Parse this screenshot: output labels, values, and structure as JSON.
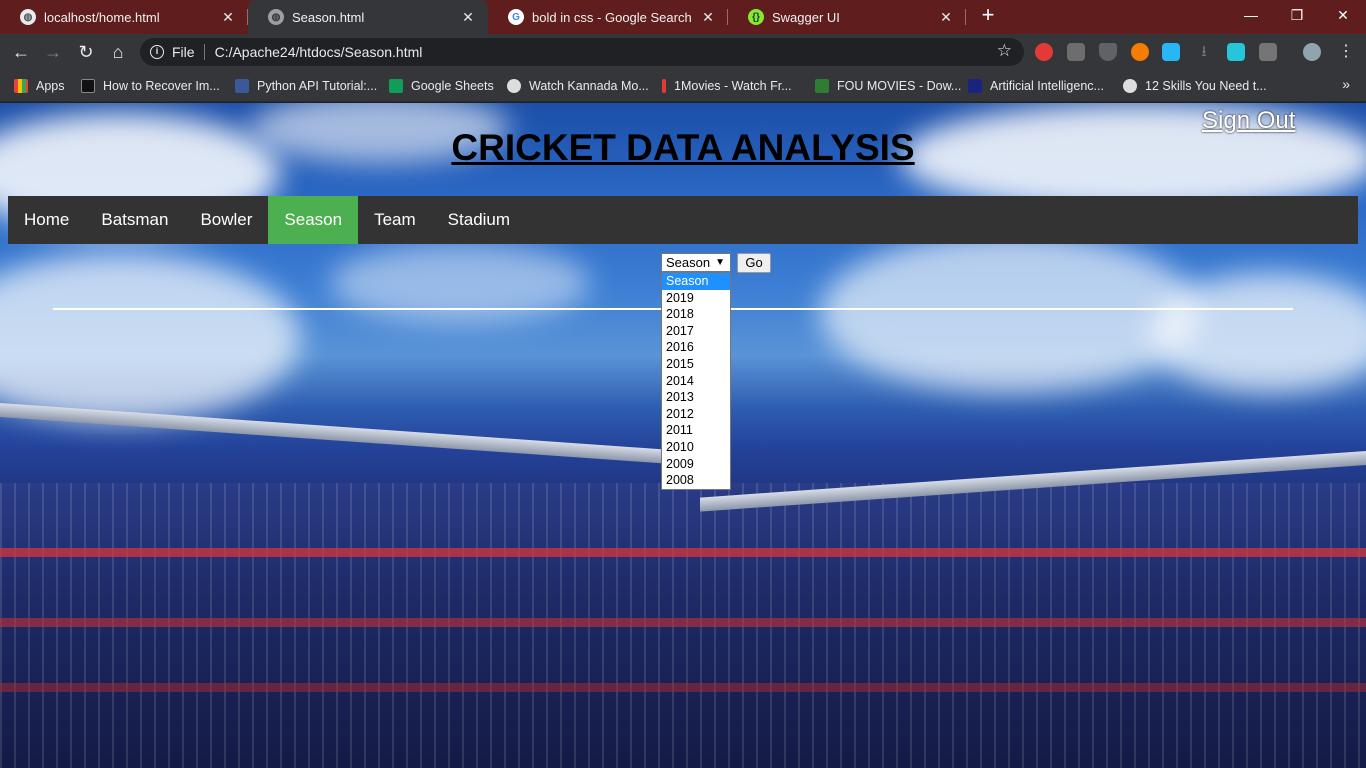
{
  "browser": {
    "tabs": [
      {
        "title": "localhost/home.html",
        "active": false,
        "favicon": "globe-icon"
      },
      {
        "title": "Season.html",
        "active": true,
        "favicon": "globe-icon"
      },
      {
        "title": "bold in css - Google Search",
        "active": false,
        "favicon": "google-icon"
      },
      {
        "title": "Swagger UI",
        "active": false,
        "favicon": "swagger-icon"
      }
    ],
    "new_tab": "+",
    "window": {
      "minimize": "—",
      "restore": "❐",
      "close": "✕"
    },
    "address": {
      "scheme": "File",
      "url": "C:/Apache24/htdocs/Season.html"
    },
    "bookmarks": [
      {
        "label": "Apps",
        "color": "#ea4335"
      },
      {
        "label": "How to Recover Im...",
        "color": "#111111"
      },
      {
        "label": "Python API Tutorial:...",
        "color": "#3b5998"
      },
      {
        "label": "Google Sheets",
        "color": "#0f9d58"
      },
      {
        "label": "Watch Kannada Mo...",
        "color": "#dddddd"
      },
      {
        "label": "1Movies - Watch Fr...",
        "color": "#e53935"
      },
      {
        "label": "FOU MOVIES - Dow...",
        "color": "#2e7d32"
      },
      {
        "label": "Artificial Intelligenc...",
        "color": "#1a237e"
      },
      {
        "label": "12 Skills You Need t...",
        "color": "#dddddd"
      }
    ],
    "more_bookmarks": "»"
  },
  "site": {
    "title": "CRICKET DATA ANALYSIS",
    "sign_out": "Sign Out",
    "menu": [
      "Home",
      "Batsman",
      "Bowler",
      "Season",
      "Team",
      "Stadium"
    ],
    "active_menu": "Season",
    "accent_color": "#4caf50",
    "season_select": {
      "value": "Season",
      "options": [
        "Season",
        "2019",
        "2018",
        "2017",
        "2016",
        "2015",
        "2014",
        "2013",
        "2012",
        "2011",
        "2010",
        "2009",
        "2008"
      ],
      "highlighted": "Season"
    },
    "go_button": "Go"
  }
}
